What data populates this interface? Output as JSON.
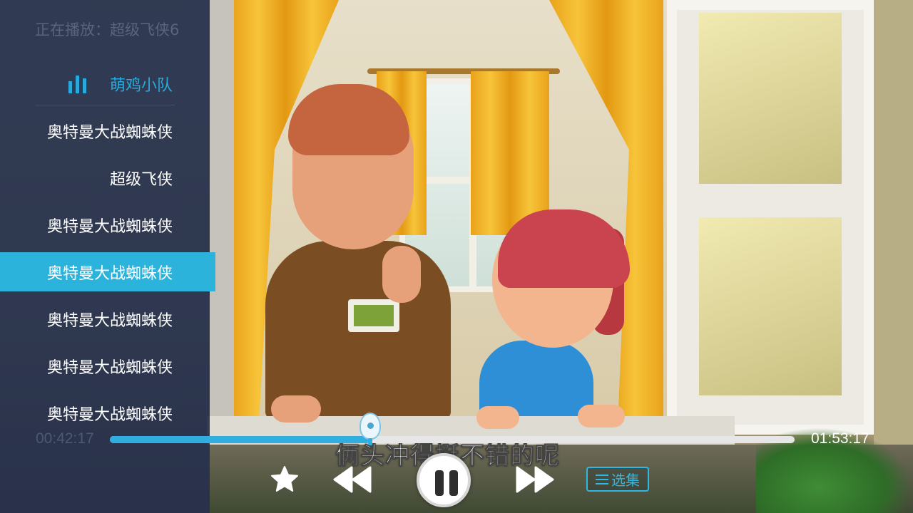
{
  "now_playing": {
    "text": "正在播放：超级飞侠6"
  },
  "playlist": {
    "title": "萌鸡小队",
    "items": [
      {
        "label": "奥特曼大战蜘蛛侠",
        "active": false
      },
      {
        "label": "超级飞侠",
        "active": false
      },
      {
        "label": "奥特曼大战蜘蛛侠",
        "active": false
      },
      {
        "label": "奥特曼大战蜘蛛侠",
        "active": true
      },
      {
        "label": "奥特曼大战蜘蛛侠",
        "active": false
      },
      {
        "label": "奥特曼大战蜘蛛侠",
        "active": false
      },
      {
        "label": "奥特曼大战蜘蛛侠",
        "active": false
      }
    ]
  },
  "video": {
    "subtitle": "俩头冲得挺不错的呢"
  },
  "player": {
    "elapsed": "00:42:17",
    "total": "01:53:17",
    "progress_fraction": 0.38,
    "episodes_label": "选集"
  },
  "icons": {
    "now_playing_indicator": "equalizer-icon",
    "favorite": "star-icon",
    "rewind": "rewind-icon",
    "pause": "pause-icon",
    "fast_forward": "fast-forward-icon",
    "episodes": "list-icon",
    "progress_thumb": "egg-mascot-icon"
  },
  "colors": {
    "accent": "#2cb3dc",
    "panel": "#222e4a",
    "text": "#ffffff",
    "muted": "#59657d"
  }
}
